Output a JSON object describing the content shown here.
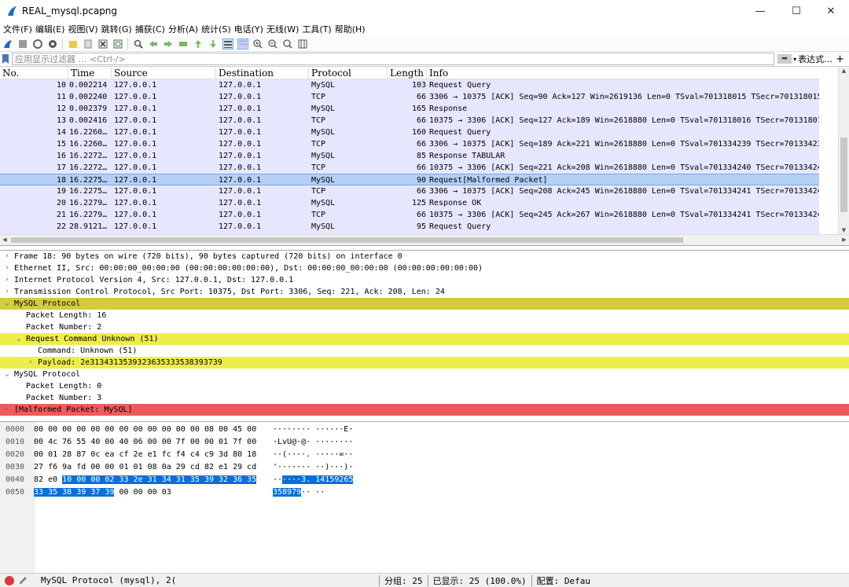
{
  "window": {
    "title": "REAL_mysql.pcapng",
    "minimize": "—",
    "maximize": "☐",
    "close": "✕"
  },
  "menu": [
    "文件(F)",
    "编辑(E)",
    "视图(V)",
    "跳转(G)",
    "捕获(C)",
    "分析(A)",
    "统计(S)",
    "电话(Y)",
    "无线(W)",
    "工具(T)",
    "帮助(H)"
  ],
  "filter": {
    "placeholder": "应用显示过滤器 … <Ctrl-/>",
    "expression_label": "表达式…",
    "add": "+"
  },
  "packet_list": {
    "columns": [
      "No.",
      "Time",
      "Source",
      "Destination",
      "Protocol",
      "Length",
      "Info"
    ],
    "rows": [
      {
        "no": "10",
        "time": "0.002214",
        "src": "127.0.0.1",
        "dst": "127.0.0.1",
        "proto": "MySQL",
        "len": "103",
        "info": "Request Query"
      },
      {
        "no": "11",
        "time": "0.002240",
        "src": "127.0.0.1",
        "dst": "127.0.0.1",
        "proto": "TCP",
        "len": "66",
        "info": "3306 → 10375 [ACK] Seq=90 Ack=127 Win=2619136 Len=0 TSval=701318015 TSecr=701318015"
      },
      {
        "no": "12",
        "time": "0.002379",
        "src": "127.0.0.1",
        "dst": "127.0.0.1",
        "proto": "MySQL",
        "len": "165",
        "info": "Response"
      },
      {
        "no": "13",
        "time": "0.002416",
        "src": "127.0.0.1",
        "dst": "127.0.0.1",
        "proto": "TCP",
        "len": "66",
        "info": "10375 → 3306 [ACK] Seq=127 Ack=189 Win=2618880 Len=0 TSval=701318016 TSecr=70131801"
      },
      {
        "no": "14",
        "time": "16.2260…",
        "src": "127.0.0.1",
        "dst": "127.0.0.1",
        "proto": "MySQL",
        "len": "160",
        "info": "Request Query"
      },
      {
        "no": "15",
        "time": "16.2260…",
        "src": "127.0.0.1",
        "dst": "127.0.0.1",
        "proto": "TCP",
        "len": "66",
        "info": "3306 → 10375 [ACK] Seq=189 Ack=221 Win=2618880 Len=0 TSval=701334239 TSecr=70133423"
      },
      {
        "no": "16",
        "time": "16.2272…",
        "src": "127.0.0.1",
        "dst": "127.0.0.1",
        "proto": "MySQL",
        "len": "85",
        "info": "Response TABULAR"
      },
      {
        "no": "17",
        "time": "16.2272…",
        "src": "127.0.0.1",
        "dst": "127.0.0.1",
        "proto": "TCP",
        "len": "66",
        "info": "10375 → 3306 [ACK] Seq=221 Ack=208 Win=2618880 Len=0 TSval=701334240 TSecr=70133424"
      },
      {
        "no": "18",
        "time": "16.2275…",
        "src": "127.0.0.1",
        "dst": "127.0.0.1",
        "proto": "MySQL",
        "len": "90",
        "info": "Request[Malformed Packet]"
      },
      {
        "no": "19",
        "time": "16.2275…",
        "src": "127.0.0.1",
        "dst": "127.0.0.1",
        "proto": "TCP",
        "len": "66",
        "info": "3306 → 10375 [ACK] Seq=208 Ack=245 Win=2618880 Len=0 TSval=701334241 TSecr=70133424"
      },
      {
        "no": "20",
        "time": "16.2279…",
        "src": "127.0.0.1",
        "dst": "127.0.0.1",
        "proto": "MySQL",
        "len": "125",
        "info": "Response OK"
      },
      {
        "no": "21",
        "time": "16.2279…",
        "src": "127.0.0.1",
        "dst": "127.0.0.1",
        "proto": "TCP",
        "len": "66",
        "info": "10375 → 3306 [ACK] Seq=245 Ack=267 Win=2618880 Len=0 TSval=701334241 TSecr=70133424"
      },
      {
        "no": "22",
        "time": "28.9121…",
        "src": "127.0.0.1",
        "dst": "127.0.0.1",
        "proto": "MySQL",
        "len": "95",
        "info": "Request Query"
      },
      {
        "no": "23",
        "time": "28.9121…",
        "src": "127.0.0.1",
        "dst": "127.0.0.1",
        "proto": "TCP",
        "len": "66",
        "info": "3306 → 10375 [ACK] Seq=267 Ack=274 Win=2618880 Len=0 TSval=701346925 TSecr=70134692"
      }
    ]
  },
  "detail": [
    {
      "indent": 0,
      "tw": ">",
      "text": "Frame 18: 90 bytes on wire (720 bits), 90 bytes captured (720 bits) on interface 0",
      "bg": ""
    },
    {
      "indent": 0,
      "tw": ">",
      "text": "Ethernet II, Src: 00:00:00_00:00:00 (00:00:00:00:00:00), Dst: 00:00:00_00:00:00 (00:00:00:00:00:00)",
      "bg": ""
    },
    {
      "indent": 0,
      "tw": ">",
      "text": "Internet Protocol Version 4, Src: 127.0.0.1, Dst: 127.0.0.1",
      "bg": ""
    },
    {
      "indent": 0,
      "tw": ">",
      "text": "Transmission Control Protocol, Src Port: 10375, Dst Port: 3306, Seq: 221, Ack: 208, Len: 24",
      "bg": ""
    },
    {
      "indent": 0,
      "tw": "v",
      "text": "MySQL Protocol",
      "bg": "#d4cc3e"
    },
    {
      "indent": 1,
      "tw": "",
      "text": "Packet Length: 16",
      "bg": ""
    },
    {
      "indent": 1,
      "tw": "",
      "text": "Packet Number: 2",
      "bg": ""
    },
    {
      "indent": 1,
      "tw": "v",
      "text": "Request Command Unknown (51)",
      "bg": "#eeee4a"
    },
    {
      "indent": 2,
      "tw": "",
      "text": "Command: Unknown (51)",
      "bg": ""
    },
    {
      "indent": 2,
      "tw": ">",
      "text": "Payload: 2e3134313539323635333538393739",
      "bg": "#eeee4a"
    },
    {
      "indent": 0,
      "tw": "v",
      "text": "MySQL Protocol",
      "bg": ""
    },
    {
      "indent": 1,
      "tw": "",
      "text": "Packet Length: 0",
      "bg": ""
    },
    {
      "indent": 1,
      "tw": "",
      "text": "Packet Number: 3",
      "bg": ""
    },
    {
      "indent": 0,
      "tw": ">",
      "text": "[Malformed Packet: MySQL]",
      "bg": "#ef5b5b"
    }
  ],
  "hex": [
    {
      "off": "0000",
      "bytes": [
        "00",
        "00",
        "00",
        "00",
        "00",
        "00",
        "00",
        "00",
        "00",
        "00",
        "00",
        "00",
        "08",
        "00",
        "45",
        "00"
      ],
      "ascii": "········ ······E·",
      "hl_from": -1,
      "hl_to": -1,
      "ahl": ""
    },
    {
      "off": "0010",
      "bytes": [
        "00",
        "4c",
        "76",
        "55",
        "40",
        "00",
        "40",
        "06",
        "00",
        "00",
        "7f",
        "00",
        "00",
        "01",
        "7f",
        "00"
      ],
      "ascii": "·LvU@·@· ········",
      "hl_from": -1,
      "hl_to": -1,
      "ahl": ""
    },
    {
      "off": "0020",
      "bytes": [
        "00",
        "01",
        "28",
        "87",
        "0c",
        "ea",
        "cf",
        "2e",
        "e1",
        "fc",
        "f4",
        "c4",
        "c9",
        "3d",
        "80",
        "18"
      ],
      "ascii": "··(····. ·····=··",
      "hl_from": -1,
      "hl_to": -1,
      "ahl": ""
    },
    {
      "off": "0030",
      "bytes": [
        "27",
        "f6",
        "9a",
        "fd",
        "00",
        "00",
        "01",
        "01",
        "08",
        "0a",
        "29",
        "cd",
        "82",
        "e1",
        "29",
        "cd"
      ],
      "ascii": "'······· ··)···)·",
      "hl_from": -1,
      "hl_to": -1,
      "ahl": ""
    },
    {
      "off": "0040",
      "bytes": [
        "82",
        "e0",
        "10",
        "00",
        "00",
        "02",
        "33",
        "2e",
        "31",
        "34",
        "31",
        "35",
        "39",
        "32",
        "36",
        "35"
      ],
      "ascii": "··",
      "hl_from": 2,
      "hl_to": 15,
      "ahl": "····3. 14159265"
    },
    {
      "off": "0050",
      "bytes": [
        "33",
        "35",
        "38",
        "39",
        "37",
        "39",
        "00",
        "00",
        "00",
        "03"
      ],
      "ascii": "",
      "hl_from": 0,
      "hl_to": 5,
      "ahl": "358979",
      "ascii_tail": "·· ··"
    }
  ],
  "status": {
    "protocol": "MySQL Protocol (mysql), 2(",
    "packets": "分组: 25",
    "displayed": "已显示: 25 (100.0%)",
    "profile": "配置: Defau"
  }
}
